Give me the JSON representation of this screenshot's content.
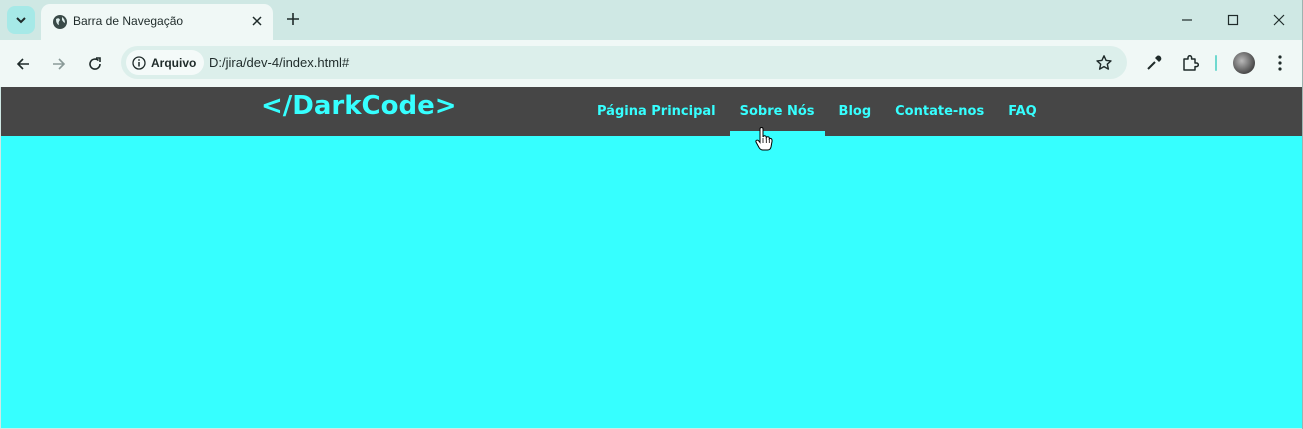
{
  "browser": {
    "tab": {
      "title": "Barra de Navegação",
      "favicon": "globe-icon"
    },
    "toolbar": {
      "site_info_label": "Arquivo",
      "url": "D:/jira/dev-4/index.html#"
    },
    "icons": [
      "chevron-down-icon",
      "close-icon",
      "plus-icon",
      "minimize-icon",
      "maximize-icon",
      "window-close-icon",
      "back-icon",
      "forward-icon",
      "reload-icon",
      "info-icon",
      "star-icon",
      "eyedropper-icon",
      "extensions-icon",
      "avatar"
    ]
  },
  "site": {
    "logo": "</DarkCode>",
    "menu": [
      {
        "label": "Página Principal"
      },
      {
        "label": "Sobre Nós",
        "active": true
      },
      {
        "label": "Blog"
      },
      {
        "label": "Contate-nos"
      },
      {
        "label": "FAQ"
      }
    ]
  },
  "colors": {
    "accent": "#36ffff",
    "nav_background": "#464646",
    "browser_frame": "#cfe8e4"
  }
}
